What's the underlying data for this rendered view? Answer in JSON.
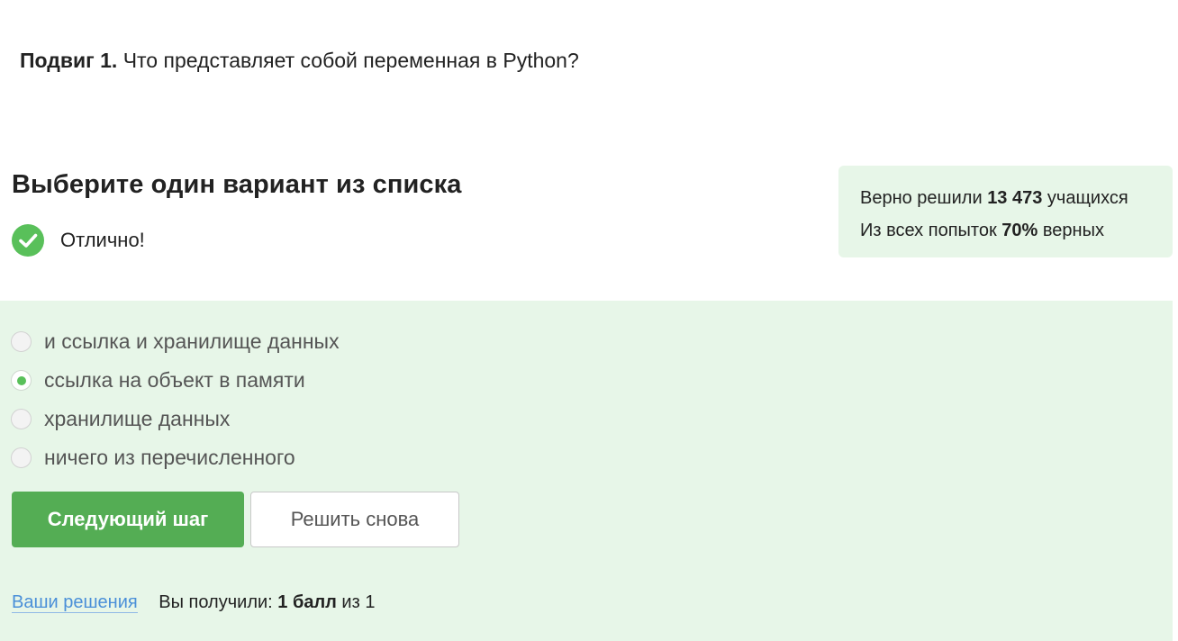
{
  "question": {
    "prefix": "Подвиг 1.",
    "text": "Что представляет собой переменная в Python?"
  },
  "section": {
    "title": "Выберите один вариант из списка"
  },
  "status": {
    "icon": "check-circle-icon",
    "text": "Отлично!"
  },
  "stats": {
    "line1_pre": "Верно решили",
    "line1_value": "13 473",
    "line1_post": "учащихся",
    "line2_pre": "Из всех попыток",
    "line2_value": "70%",
    "line2_post": "верных"
  },
  "options": [
    {
      "label": "и ссылка и хранилище данных",
      "selected": false
    },
    {
      "label": "ссылка на объект в памяти",
      "selected": true
    },
    {
      "label": "хранилище данных",
      "selected": false
    },
    {
      "label": "ничего из перечисленного",
      "selected": false
    }
  ],
  "buttons": {
    "next_label": "Следующий шаг",
    "retry_label": "Решить снова"
  },
  "footer": {
    "solutions_link": "Ваши решения",
    "score_pre": "Вы получили:",
    "score_value": "1 балл",
    "score_post": "из 1"
  },
  "colors": {
    "accent_green": "#54ad54",
    "panel_bg": "#e7f6e8",
    "link_blue": "#4a8fd8"
  }
}
